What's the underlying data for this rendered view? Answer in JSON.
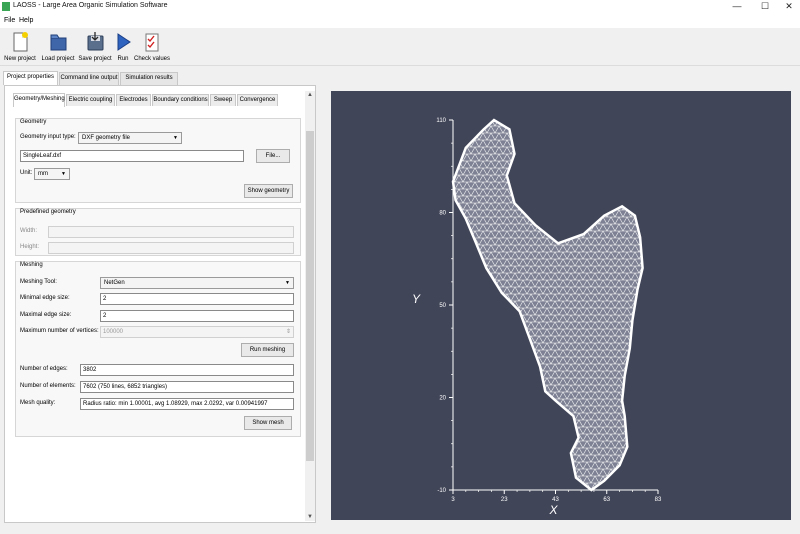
{
  "window": {
    "title": "LAOSS - Large Area Organic Simulation Software",
    "minimize": "—",
    "maximize": "☐",
    "close": "✕"
  },
  "menu": [
    "File",
    "Help"
  ],
  "toolbar": {
    "new_project": "New project",
    "load_project": "Load project",
    "save_project": "Save project",
    "run": "Run",
    "check_values": "Check values"
  },
  "outer_tabs": [
    "Project properties",
    "Command line output",
    "Simulation results"
  ],
  "inner_tabs": [
    "Geometry/Meshing",
    "Electric coupling",
    "Electrodes",
    "Boundary conditions",
    "Sweep",
    "Convergence"
  ],
  "geometry": {
    "title": "Geometry",
    "input_type_label": "Geometry input type:",
    "input_type_value": "DXF geometry file",
    "file_value": "SingleLeaf.dxf",
    "file_button": "File...",
    "unit_label": "Unit:",
    "unit_value": "mm",
    "show_button": "Show geometry"
  },
  "predefined": {
    "title": "Predefined geometry",
    "width_label": "Width:",
    "height_label": "Height:"
  },
  "meshing": {
    "title": "Meshing",
    "tool_label": "Meshing Tool:",
    "tool_value": "NetGen",
    "min_edge_label": "Minimal edge size:",
    "min_edge_value": "2",
    "max_edge_label": "Maximal edge size:",
    "max_edge_value": "2",
    "max_vertices_label": "Maximum number of vertices:",
    "max_vertices_value": "100000",
    "run_button": "Run meshing",
    "edges_label": "Number of edges:",
    "edges_value": "3802",
    "elements_label": "Number of elements:",
    "elements_value": "7602 (750 lines, 6852 triangles)",
    "quality_label": "Mesh quality:",
    "quality_value": "Radius ratio: min 1.00001, avg 1.08929, max 2.0292, var 0.00941997",
    "show_button": "Show mesh"
  },
  "chart_data": {
    "type": "scatter",
    "xlabel": "X",
    "ylabel": "Y",
    "x_ticks": [
      "3",
      "23",
      "43",
      "63",
      "83"
    ],
    "y_ticks": [
      "-10",
      "20",
      "50",
      "80",
      "110"
    ],
    "xlim": [
      3,
      83
    ],
    "ylim": [
      -10,
      110
    ],
    "outline": [
      [
        3,
        90
      ],
      [
        8,
        101
      ],
      [
        15,
        107
      ],
      [
        19,
        110
      ],
      [
        25,
        107
      ],
      [
        27,
        99
      ],
      [
        24,
        92
      ],
      [
        27,
        83
      ],
      [
        35,
        76
      ],
      [
        44,
        70
      ],
      [
        54,
        73
      ],
      [
        62,
        79
      ],
      [
        69,
        82
      ],
      [
        74,
        79
      ],
      [
        76,
        72
      ],
      [
        77,
        62
      ],
      [
        75,
        55
      ],
      [
        73,
        45
      ],
      [
        72,
        36
      ],
      [
        70,
        27
      ],
      [
        69,
        19
      ],
      [
        70,
        14
      ],
      [
        71,
        4
      ],
      [
        68,
        -2
      ],
      [
        62,
        -7
      ],
      [
        57,
        -10
      ],
      [
        51,
        -6
      ],
      [
        49,
        2
      ],
      [
        52,
        7
      ],
      [
        50,
        14
      ],
      [
        43,
        19
      ],
      [
        39,
        22
      ],
      [
        37,
        30
      ],
      [
        33,
        39
      ],
      [
        29,
        48
      ],
      [
        22,
        54
      ],
      [
        16,
        62
      ],
      [
        12,
        70
      ],
      [
        8,
        78
      ],
      [
        4,
        84
      ]
    ],
    "background": "#414558",
    "mesh_color": "#ffffff"
  }
}
